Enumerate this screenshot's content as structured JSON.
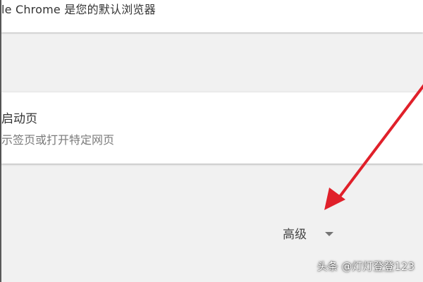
{
  "default_browser": {
    "text": "le Chrome 是您的默认浏览器"
  },
  "startup": {
    "title": "启动页",
    "subtitle": "示签页或打开特定网页"
  },
  "advanced": {
    "label": "高级",
    "icon": "caret-down-icon"
  },
  "annotation": {
    "arrow_color": "#e0202a",
    "icon": "red-arrow-annotation"
  },
  "watermark": {
    "text": "头条 @灯灯登登123"
  }
}
